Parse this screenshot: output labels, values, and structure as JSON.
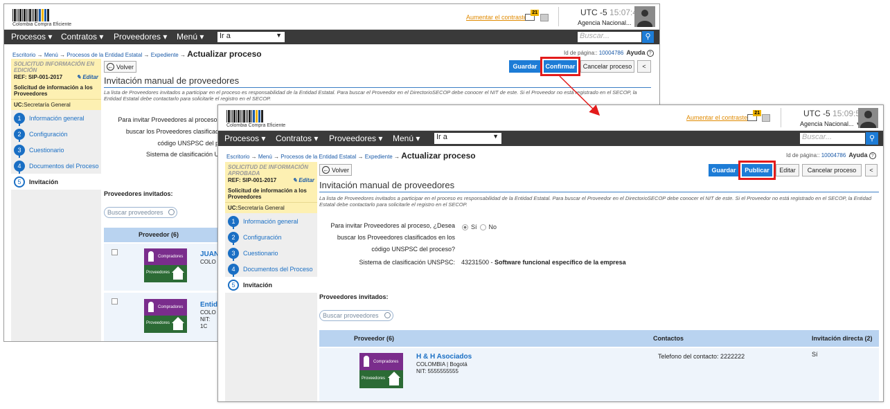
{
  "brand": {
    "name": "Colombia Compra Eficiente"
  },
  "header": {
    "contrast_link": "Aumentar el contraste",
    "mail_badge": "21",
    "timezone": "UTC -5",
    "agency": "Agencia Nacional..."
  },
  "nav": {
    "items": [
      "Procesos",
      "Contratos",
      "Proveedores",
      "Menú"
    ],
    "goto_value": "Ir a",
    "search_placeholder": "Buscar..."
  },
  "breadcrumb": {
    "items": [
      "Escritorio",
      "Menú",
      "Procesos de la Entidad Estatal",
      "Expediente"
    ],
    "current": "Actualizar proceso"
  },
  "page_id": {
    "label": "Id de página::",
    "value": "10004786",
    "help": "Ayuda"
  },
  "sidebar": {
    "ref": "REF: SIP-001-2017",
    "edit": "Editar",
    "desc": "Solicitud de información a los Proveedores",
    "uc_label": "UC:",
    "uc_value": "Secretaría General",
    "steps": [
      {
        "n": "1",
        "label": "Información general"
      },
      {
        "n": "2",
        "label": "Configuración"
      },
      {
        "n": "3",
        "label": "Cuestionario"
      },
      {
        "n": "4",
        "label": "Documentos del Proceso"
      },
      {
        "n": "5",
        "label": "Invitación"
      }
    ]
  },
  "actions": {
    "back": "Volver",
    "save": "Guardar",
    "confirm": "Confirmar",
    "publish": "Publicar",
    "edit": "Editar",
    "cancel": "Cancelar proceso",
    "collapse": "<"
  },
  "section": {
    "title": "Invitación manual de proveedores",
    "description": "La lista de Proveedores invitados a participar en el proceso es responsabilidad de la Entidad Estatal. Para buscar el Proveedor en el DirectorioSECOP debe conocer el NIT de este. Si el Proveedor no está registrado en el SECOP, la Entidad Estatal debe contactarlo para solicitarle el registro en el SECOP.",
    "question_lines": [
      "Para invitar Proveedores al proceso, ¿Desea",
      "buscar los Proveedores clasificados en los",
      "código UNSPSC del proceso?"
    ],
    "radio_yes": "Sí",
    "radio_no": "No",
    "unspsc_label": "Sistema de clasificación UNSPSC:",
    "unspsc_code": "43231500",
    "unspsc_desc": "Software funcional específico de la empresa"
  },
  "back_window": {
    "time": "15:07:45",
    "status": "SOLICITUD INFORMACIÓN EN EDICIÓN",
    "question_lines": [
      "Para invitar Proveedores al proceso,",
      "buscar los Proveedores clasificad",
      "código UNSPSC del p"
    ],
    "unspsc_label": "Sistema de clasificación U",
    "rows": [
      {
        "name": "JUAN",
        "line1": "COLO"
      },
      {
        "name": "Entid",
        "line1": "COLO",
        "line2": "NIT: 1C"
      }
    ]
  },
  "front_window": {
    "time": "15:09:58",
    "status": "SOLICITUD DE INFORMACIÓN APROBADA"
  },
  "invited": {
    "title": "Proveedores invitados:",
    "search_placeholder": "Buscar proveedores",
    "col_provider": "Proveedor (6)",
    "col_contacts": "Contactos",
    "col_direct": "Invitación directa (2)",
    "logo_top": "Compradores",
    "logo_bottom": "Proveedores",
    "rows": [
      {
        "name": "H & H Asociados",
        "location": "COLOMBIA | Bogotá",
        "nit": "NIT: 5555555555",
        "contact": "Telefono del contacto: 2222222",
        "direct": "Sí"
      }
    ]
  },
  "colors": {
    "accent": "#1d7cd6",
    "highlight": "#e31b1b",
    "nav": "#3a3a3a",
    "sidebar_head": "#fdf0b2"
  }
}
